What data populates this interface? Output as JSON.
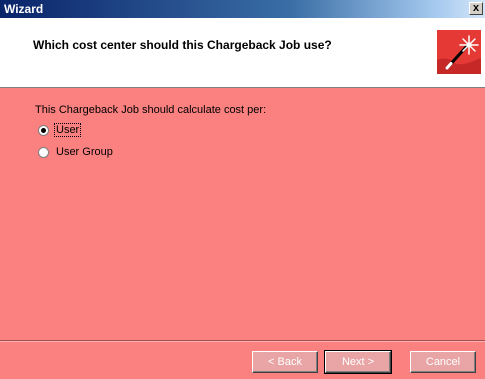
{
  "window": {
    "title": "Wizard",
    "close_label": "x"
  },
  "header": {
    "question": "Which cost center should this Chargeback Job use?"
  },
  "body": {
    "prompt": "This Chargeback Job should calculate cost per:",
    "options": [
      {
        "label": "User",
        "checked": true
      },
      {
        "label": "User Group",
        "checked": false
      }
    ]
  },
  "buttons": {
    "back": "< Back",
    "next": "Next >",
    "cancel": "Cancel"
  },
  "colors": {
    "panel_background": "#fb8080",
    "header_background": "#ffffff",
    "titlebar_start": "#0a246a"
  }
}
